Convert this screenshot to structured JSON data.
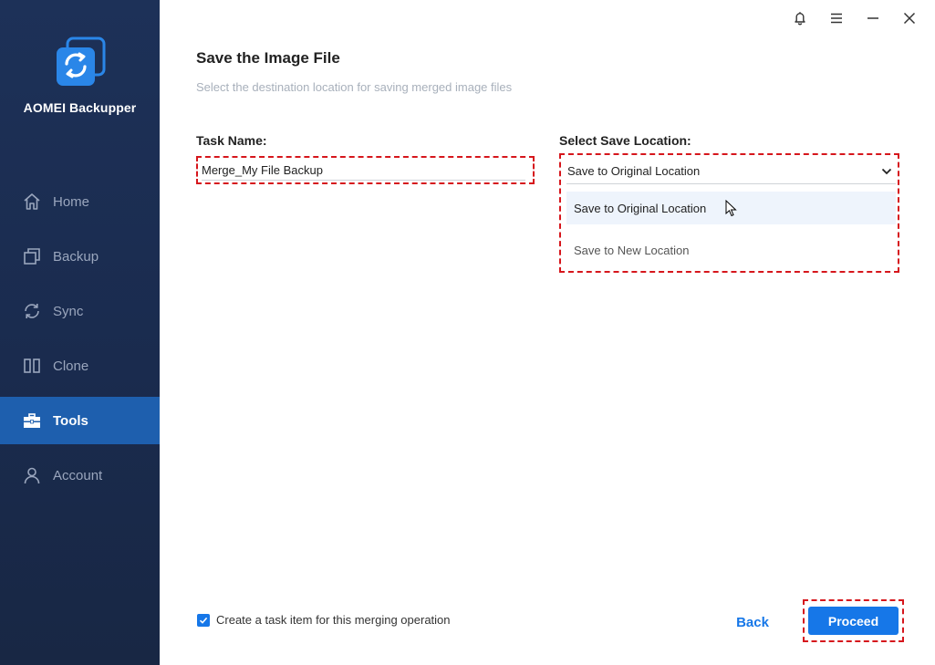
{
  "app": {
    "name": "AOMEI Backupper",
    "colors": {
      "sidebar": "#1a2b4e",
      "active_nav": "#1e5fae",
      "accent": "#1677e8",
      "highlight": "#d6161c"
    }
  },
  "sidebar": {
    "items": [
      {
        "label": "Home",
        "icon": "home-icon",
        "active": false
      },
      {
        "label": "Backup",
        "icon": "backup-icon",
        "active": false
      },
      {
        "label": "Sync",
        "icon": "sync-icon",
        "active": false
      },
      {
        "label": "Clone",
        "icon": "clone-icon",
        "active": false
      },
      {
        "label": "Tools",
        "icon": "tools-icon",
        "active": true
      },
      {
        "label": "Account",
        "icon": "account-icon",
        "active": false
      }
    ]
  },
  "window_controls": [
    "bell-icon",
    "menu-icon",
    "minimize-icon",
    "close-icon"
  ],
  "page": {
    "title": "Save the Image File",
    "subtitle": "Select the destination location for saving merged image files"
  },
  "task": {
    "label": "Task Name:",
    "value": "Merge_My File Backup"
  },
  "save_location": {
    "label": "Select Save Location:",
    "selected": "Save to Original Location",
    "options": [
      "Save to Original Location",
      "Save to New Location"
    ]
  },
  "footer": {
    "checkbox_label": "Create a task item for this merging operation",
    "checkbox_checked": true,
    "back_label": "Back",
    "proceed_label": "Proceed"
  }
}
